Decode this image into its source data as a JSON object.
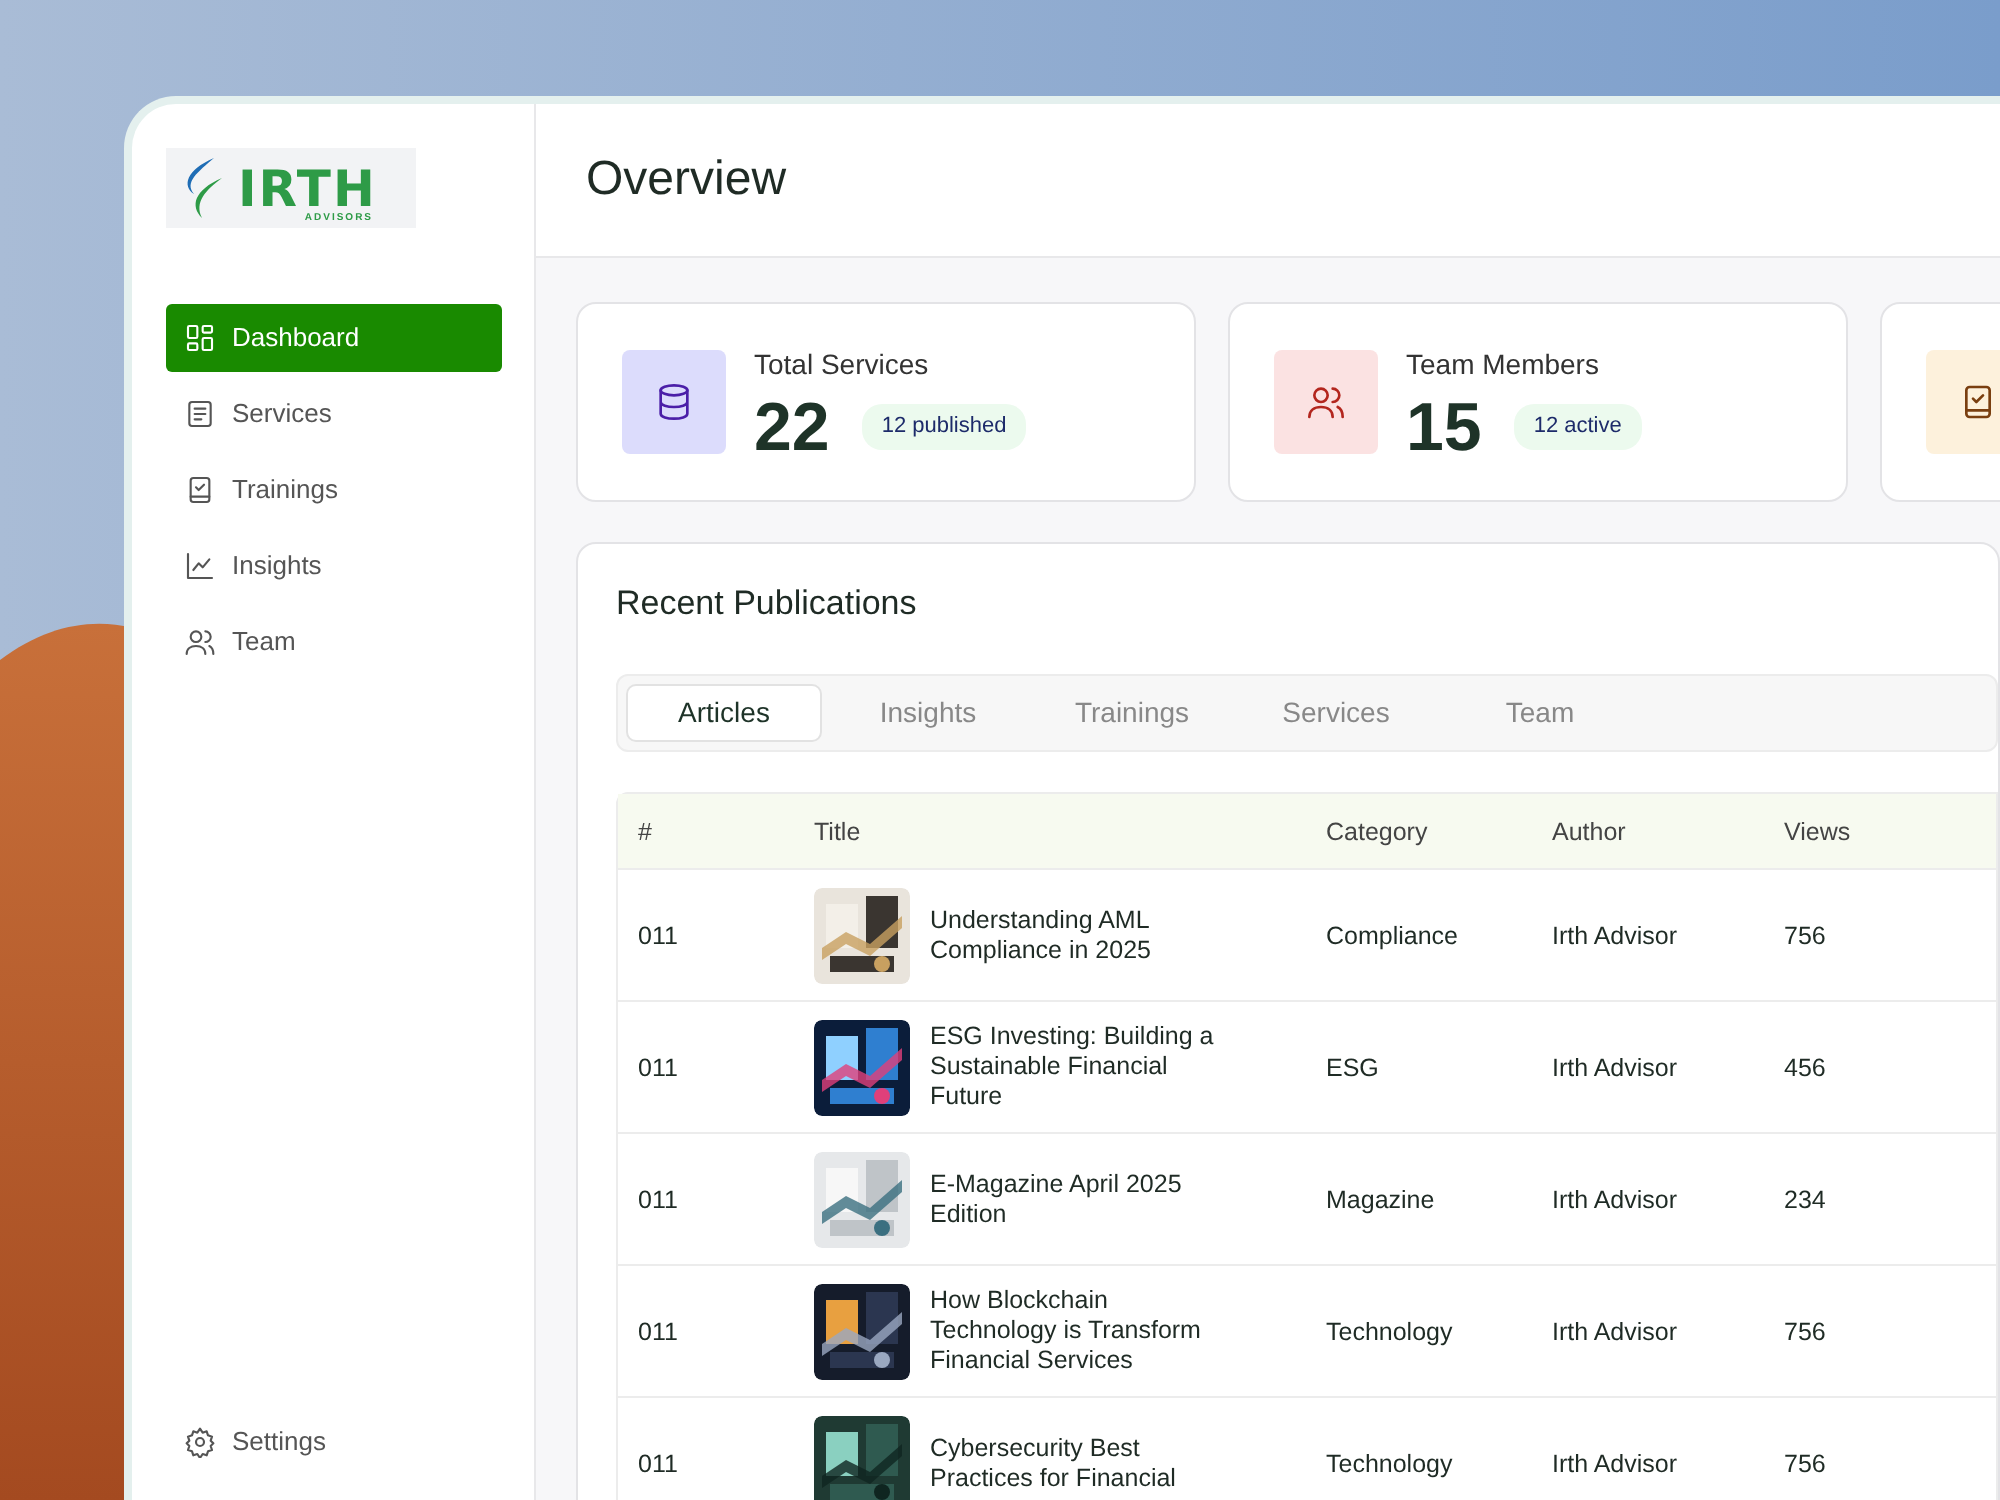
{
  "logo": {
    "name": "IRTH",
    "tagline": "ADVISORS"
  },
  "sidebar": {
    "items": [
      {
        "label": "Dashboard",
        "kind": "dashboard",
        "selected": true
      },
      {
        "label": "Services",
        "kind": "services",
        "selected": false
      },
      {
        "label": "Trainings",
        "kind": "trainings",
        "selected": false
      },
      {
        "label": "Insights",
        "kind": "insights",
        "selected": false
      },
      {
        "label": "Team",
        "kind": "team",
        "selected": false
      }
    ],
    "footer": {
      "label": "Settings"
    }
  },
  "header": {
    "title": "Overview"
  },
  "stats": [
    {
      "kind": "services",
      "label": "Total Services",
      "value": "22",
      "badge": "12 published"
    },
    {
      "kind": "team",
      "label": "Team Members",
      "value": "15",
      "badge": "12 active"
    },
    {
      "kind": "trainings"
    }
  ],
  "publications": {
    "title": "Recent Publications",
    "tabs": [
      {
        "label": "Articles",
        "selected": true
      },
      {
        "label": "Insights",
        "selected": false
      },
      {
        "label": "Trainings",
        "selected": false
      },
      {
        "label": "Services",
        "selected": false
      },
      {
        "label": "Team",
        "selected": false
      }
    ],
    "table": {
      "columns": [
        "#",
        "Title",
        "Category",
        "Author",
        "Views"
      ],
      "rows": [
        {
          "number": "011",
          "title": "Understanding AML Compliance in 2025",
          "category": "Compliance",
          "author": "Irth Advisor",
          "views": "756"
        },
        {
          "number": "011",
          "title": "ESG Investing: Building a Sustainable Financial Future",
          "category": "ESG",
          "author": "Irth Advisor",
          "views": "456"
        },
        {
          "number": "011",
          "title": "E-Magazine April 2025 Edition",
          "category": "Magazine",
          "author": "Irth Advisor",
          "views": "234"
        },
        {
          "number": "011",
          "title": "How Blockchain Technology is Transform Financial Services",
          "category": "Technology",
          "author": "Irth Advisor",
          "views": "756"
        },
        {
          "number": "011",
          "title": "Cybersecurity Best Practices for Financial",
          "category": "Technology",
          "author": "Irth Advisor",
          "views": "756"
        }
      ]
    }
  }
}
